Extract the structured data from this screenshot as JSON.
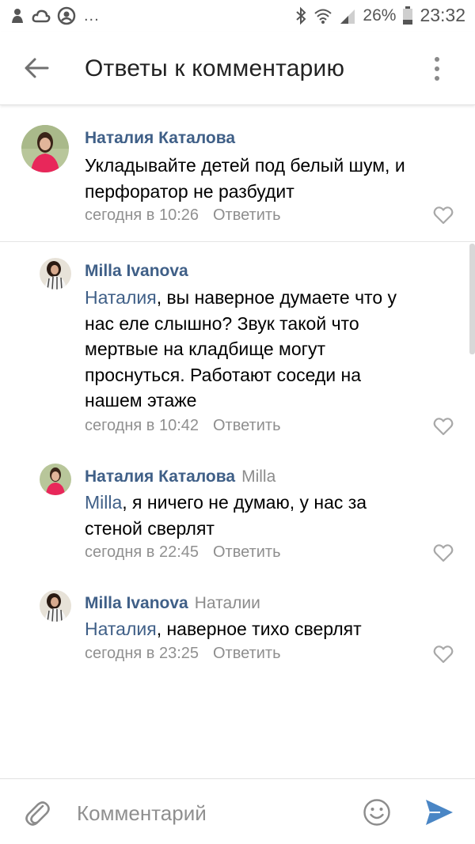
{
  "status_bar": {
    "battery": "26%",
    "time": "23:32",
    "overflow": "..."
  },
  "header": {
    "title": "Ответы к комментарию"
  },
  "comments": [
    {
      "author": "Наталия Каталова",
      "reply_to": "",
      "mention": "",
      "text": "Укладывайте детей под белый шум, и перфоратор не разбудит",
      "time": "сегодня в 10:26",
      "reply_label": "Ответить"
    },
    {
      "author": "Milla Ivanova",
      "reply_to": "",
      "mention": "Наталия",
      "text": ", вы наверное думаете что у нас еле слышно? Звук такой что мертвые на кладбище могут проснуться. Работают соседи на нашем этаже",
      "time": "сегодня в 10:42",
      "reply_label": "Ответить"
    },
    {
      "author": "Наталия Каталова",
      "reply_to": "Milla",
      "mention": "Milla",
      "text": ", я ничего не думаю, у нас за стеной сверлят",
      "time": "сегодня в 22:45",
      "reply_label": "Ответить"
    },
    {
      "author": "Milla Ivanova",
      "reply_to": "Наталии",
      "mention": "Наталия",
      "text": ", наверное тихо сверлят",
      "time": "сегодня в 23:25",
      "reply_label": "Ответить"
    }
  ],
  "input": {
    "placeholder": "Комментарий"
  },
  "colors": {
    "accent": "#3f5f87",
    "send": "#4a86c5",
    "meta": "#909090"
  },
  "icons": [
    "back-arrow-icon",
    "more-vert-icon",
    "heart-icon",
    "attach-icon",
    "emoji-icon",
    "send-icon"
  ]
}
